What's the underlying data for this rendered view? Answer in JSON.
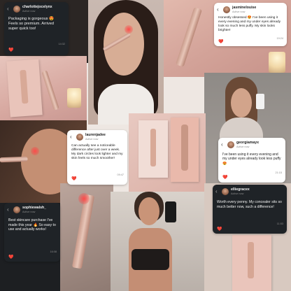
{
  "colors": {
    "heart": "#e0304a",
    "device_rose_gold": "#d8ab9b",
    "dark_card": "#1f2327"
  },
  "icons": {
    "back": "‹",
    "heart": "❤️",
    "emoji_heart_eyes": "😍",
    "emoji_heart_eyes_2": "😍",
    "emoji_fire": "🔥"
  },
  "cards": [
    {
      "username": "charlottejocelynx",
      "status": "Active now",
      "message": "Packaging is gorgeous 😍 Feels so premium. Arrived super quick too!",
      "time": "14:32"
    },
    {
      "username": "jasminelouise",
      "status": "Active now",
      "message": "Honestly obsessed 😍 I've been using it every evening and my under eyes already look so much less puffy. My skin looks brighter!",
      "time": "19:24"
    },
    {
      "username": "laurenjadee",
      "status": "Active now",
      "message": "Can actually see a noticeable difference after just over a week. My dark circles look lighter and my skin feels so much smoother!",
      "time": "09:47"
    },
    {
      "username": "georgiamayx",
      "status": "Active now",
      "message": "I've been using it every evening and my under eyes already look less puffy 😍",
      "time": "21:15"
    },
    {
      "username": "sophiewalsh_",
      "status": "Active now",
      "message": "Best skincare purchase I've made this year 🔥 So easy to use and actually works!",
      "time": "16:08"
    },
    {
      "username": "elliegracex",
      "status": "Active now",
      "message": "Worth every penny. My concealer sits so much better now, such a difference!",
      "time": "11:53"
    }
  ]
}
